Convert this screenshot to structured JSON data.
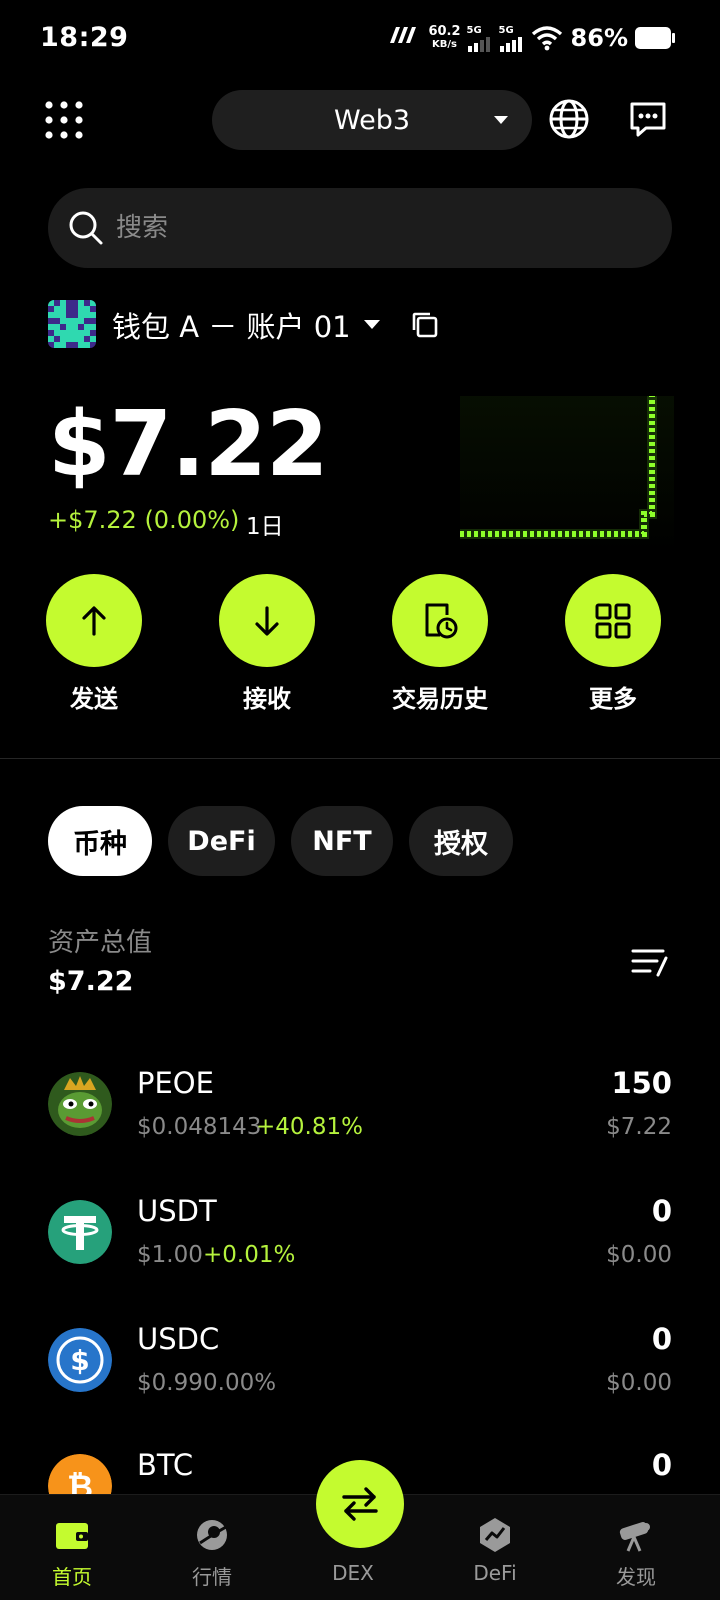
{
  "status_bar": {
    "time": "18:29",
    "carrier_logo": "?",
    "net_speed": "60.2",
    "net_speed_unit": "KB/s",
    "sim1": "5G",
    "sim2": "5G",
    "battery": "86%"
  },
  "header": {
    "network": "Web3",
    "icons": [
      "grid-menu-icon",
      "globe-icon",
      "chat-icon"
    ]
  },
  "search": {
    "placeholder": "搜索"
  },
  "wallet": {
    "name": "钱包 A － 账户 01"
  },
  "balance": {
    "total": "$7.22",
    "change": "+$7.22 (0.00%)",
    "period": "1日"
  },
  "actions": [
    {
      "label": "发送",
      "icon": "arrow-up-icon"
    },
    {
      "label": "接收",
      "icon": "arrow-down-icon"
    },
    {
      "label": "交易历史",
      "icon": "history-icon"
    },
    {
      "label": "更多",
      "icon": "more-grid-icon"
    }
  ],
  "tabs": [
    {
      "label": "币种",
      "active": true
    },
    {
      "label": "DeFi",
      "active": false
    },
    {
      "label": "NFT",
      "active": false
    },
    {
      "label": "授权",
      "active": false
    }
  ],
  "assets": {
    "total_label": "资产总值",
    "total_value": "$7.22"
  },
  "tokens": [
    {
      "symbol": "PEOE",
      "price": "$0.048143",
      "change": "+40.81%",
      "change_color": "#b5f23d",
      "quantity": "150",
      "value": "$7.22"
    },
    {
      "symbol": "USDT",
      "price": "$1.00",
      "change": "+0.01%",
      "change_color": "#b5f23d",
      "quantity": "0",
      "value": "$0.00"
    },
    {
      "symbol": "USDC",
      "price": "$0.99",
      "change": "0.00%",
      "change_color": "#8a8a8a",
      "quantity": "0",
      "value": "$0.00"
    },
    {
      "symbol": "BTC",
      "price": "",
      "change": "",
      "change_color": "#8a8a8a",
      "quantity": "0",
      "value": ""
    }
  ],
  "bottom_nav": [
    {
      "label": "首页",
      "icon": "wallet-icon",
      "active": true
    },
    {
      "label": "行情",
      "icon": "market-icon",
      "active": false
    },
    {
      "label": "DEX",
      "icon": "swap-icon",
      "active": false
    },
    {
      "label": "DeFi",
      "icon": "defi-icon",
      "active": false
    },
    {
      "label": "发现",
      "icon": "discover-icon",
      "active": false
    }
  ],
  "colors": {
    "accent": "#c4fb2f",
    "positive": "#b5f23d",
    "background": "#000000",
    "muted_text": "#8a8a8a"
  }
}
